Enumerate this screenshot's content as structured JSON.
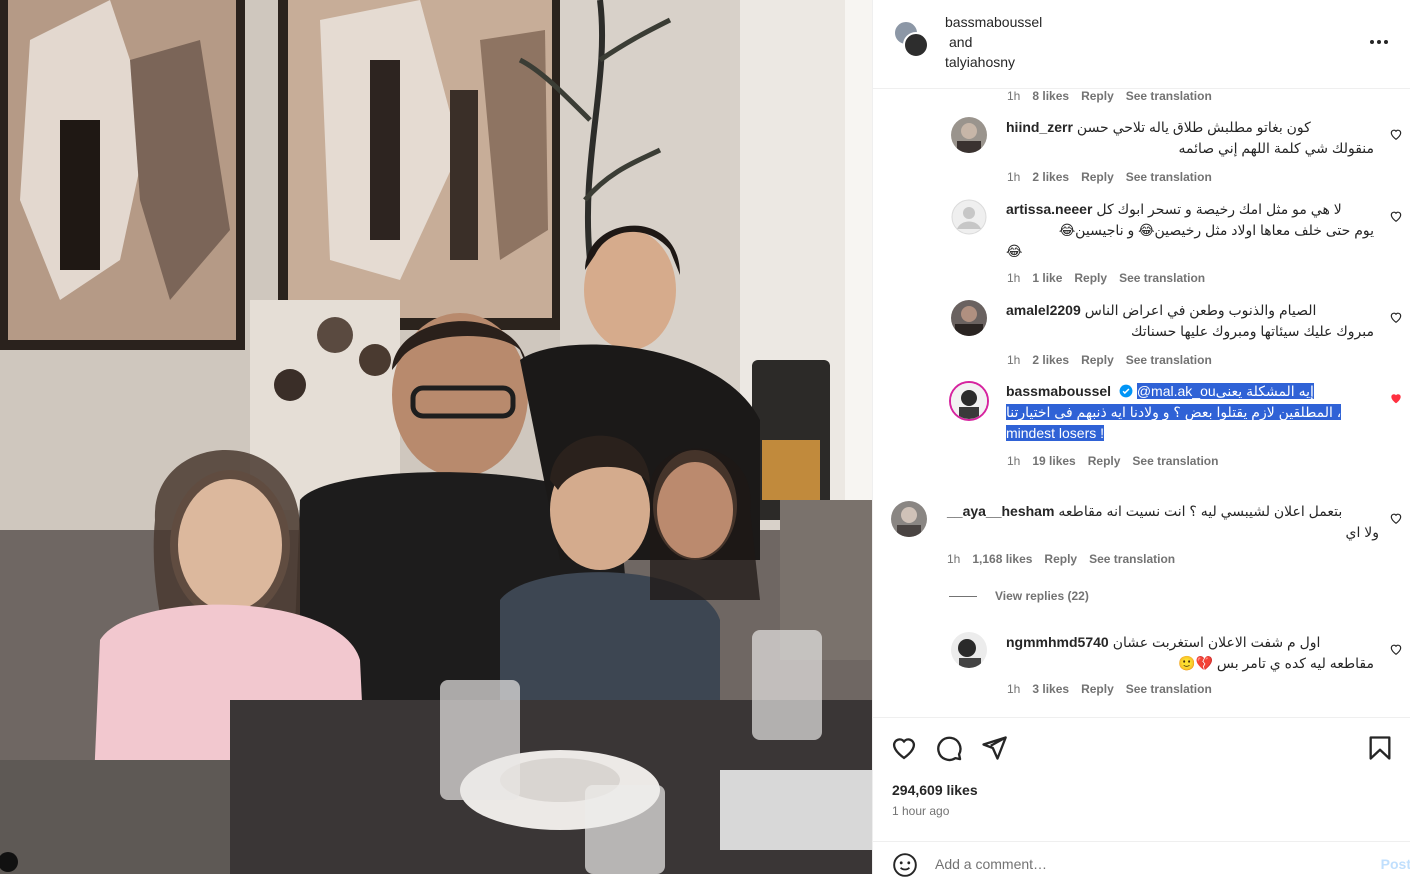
{
  "post": {
    "authors": [
      "bassmaboussel",
      "talyiahosny"
    ],
    "and_label": "and",
    "more_label": "•••"
  },
  "comments": [
    {
      "time": "1h",
      "likes": "8 likes",
      "reply": "Reply",
      "translate": "See translation"
    },
    {
      "user": "hiind_zerr",
      "text_l1": "كون بغاتو مطلبش طلاق ياله تلاحي حسن",
      "text_l2": "منقولك شي كلمة اللهم إني صائمه",
      "time": "1h",
      "likes": "2 likes",
      "reply": "Reply",
      "translate": "See translation"
    },
    {
      "user": "artissa.neeer",
      "text_l1": "لا هي مو مثل امك رخيصة و تسحر ابوك كل",
      "text_l2": "يوم حتى خلف معاها اولاد مثل رخيصين😂 و ناجيسين😂",
      "text_l3": "😂",
      "time": "1h",
      "likes": "1 like",
      "reply": "Reply",
      "translate": "See translation"
    },
    {
      "user": "amalel2209",
      "text_l1": "الصيام والذنوب وطعن في اعراض الناس",
      "text_l2": "مبروك عليك سيئاتها ومبروك عليها حسناتك",
      "time": "1h",
      "likes": "2 likes",
      "reply": "Reply",
      "translate": "See translation"
    },
    {
      "user": "bassmaboussel",
      "verified": true,
      "mention": "@mal.ak_ou",
      "text_l1": "إيه المشكلة يعنى",
      "text_l2": "، المطلقين لازم يقتلوا بعض ؟ و ولادنا ايه ذنبهم فى اختيارتنا",
      "text_l3": "mindest losers !",
      "time": "1h",
      "likes": "19 likes",
      "reply": "Reply",
      "translate": "See translation",
      "liked": true
    },
    {
      "user": "__aya__hesham",
      "text_l1": "بتعمل اعلان لشيبسي ليه ؟ انت نسيت انه مقاطعه",
      "text_l2": "ولا اي",
      "time": "1h",
      "likes": "1,168 likes",
      "reply": "Reply",
      "translate": "See translation"
    },
    {
      "user": "ngmmhmd5740",
      "text_l1": "اول م شفت الاعلان استغربت عشان",
      "text_l2": "مقاطعه ليه كده ي تامر بس 💔🙂",
      "time": "1h",
      "likes": "3 likes",
      "reply": "Reply",
      "translate": "See translation"
    }
  ],
  "view_replies": "View replies (22)",
  "actions": {
    "likes": "294,609 likes",
    "time_ago": "1 hour ago"
  },
  "add_comment": {
    "placeholder": "Add a comment…",
    "post_label": "Post"
  },
  "colors": {
    "heart_red": "#ff3040",
    "link_blue": "#0095f6",
    "highlight": "#2f62d6",
    "post_disabled": "#c0dffd"
  },
  "icons": [
    "like-icon",
    "comment-icon",
    "share-icon",
    "save-icon",
    "emoji-icon",
    "verified-icon",
    "heart-icon"
  ]
}
